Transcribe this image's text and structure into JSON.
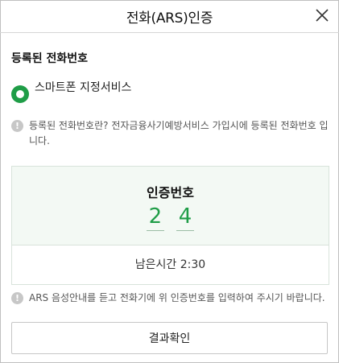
{
  "dialog": {
    "title": "전화(ARS)인증",
    "close_icon": "close-icon"
  },
  "registered_phone": {
    "section_title": "등록된 전화번호",
    "option_label": "스마트폰 지정서비스",
    "option_selected": true,
    "info_text": "등록된 전화번호란? 전자금융사기예방서비스 가입시에 등록된 전화번호 입니다.",
    "info_icon": "info-icon"
  },
  "verification": {
    "label": "인증번호",
    "digits": [
      "2",
      "4"
    ],
    "remaining_label": "남은시간 2:30"
  },
  "instruction": {
    "text": "ARS 음성안내를 듣고 전화기에 위 인증번호를 입력하여 주시기 바랍니다.",
    "icon": "info-icon"
  },
  "actions": {
    "confirm_label": "결과확인"
  },
  "colors": {
    "accent": "#1f9d47",
    "code_bg": "#f3f9f4",
    "border": "#c6c6c6"
  }
}
